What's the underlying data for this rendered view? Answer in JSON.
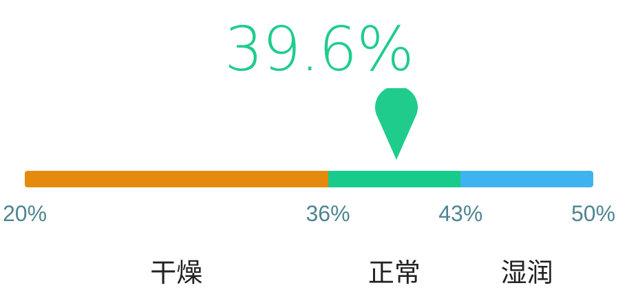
{
  "humidity": {
    "reading_label": "39.6%",
    "reading_value": 39.6,
    "scale": {
      "min": 20,
      "max": 50,
      "ticks": [
        {
          "value": 20,
          "label": "20%"
        },
        {
          "value": 36,
          "label": "36%"
        },
        {
          "value": 43,
          "label": "43%"
        },
        {
          "value": 50,
          "label": "50%"
        }
      ]
    },
    "zones": [
      {
        "name": "dry",
        "label": "干燥",
        "from": 20,
        "to": 36,
        "color": "#e58a0c"
      },
      {
        "name": "normal",
        "label": "正常",
        "from": 36,
        "to": 43,
        "color": "#17cc8b"
      },
      {
        "name": "humid",
        "label": "湿润",
        "from": 43,
        "to": 50,
        "color": "#3db3f0"
      }
    ]
  },
  "colors": {
    "reading": "#1fcc8c",
    "pin": "#1fcc8c",
    "tick_text": "#4f8591",
    "zone_text": "#222222"
  },
  "icons": {
    "marker": "location-pin-icon"
  }
}
